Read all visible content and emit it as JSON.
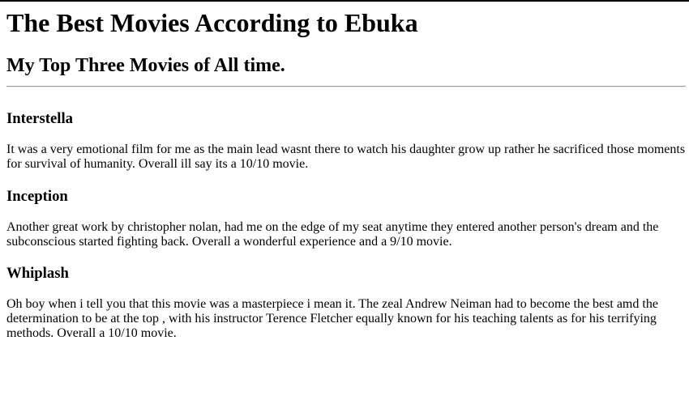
{
  "page": {
    "title": "The Best Movies According to Ebuka",
    "subtitle": "My Top Three Movies of All time."
  },
  "movies": [
    {
      "title": "Interstella",
      "review": "It was a very emotional film for me as the main lead wasnt there to watch his daughter grow up rather he sacrificed those moments for survival of humanity. Overall ill say its a 10/10 movie."
    },
    {
      "title": "Inception",
      "review": "Another great work by christopher nolan, had me on the edge of my seat anytime they entered another person's dream and the subconscious started fighting back. Overall a wonderful experience and a 9/10 movie."
    },
    {
      "title": "Whiplash",
      "review": "Oh boy when i tell you that this movie was a masterpiece i mean it. The zeal Andrew Neiman had to become the best amd the determination to be at the top , with his instructor Terence Fletcher equally known for his teaching talents as for his terrifying methods. Overall a 10/10 movie."
    }
  ]
}
